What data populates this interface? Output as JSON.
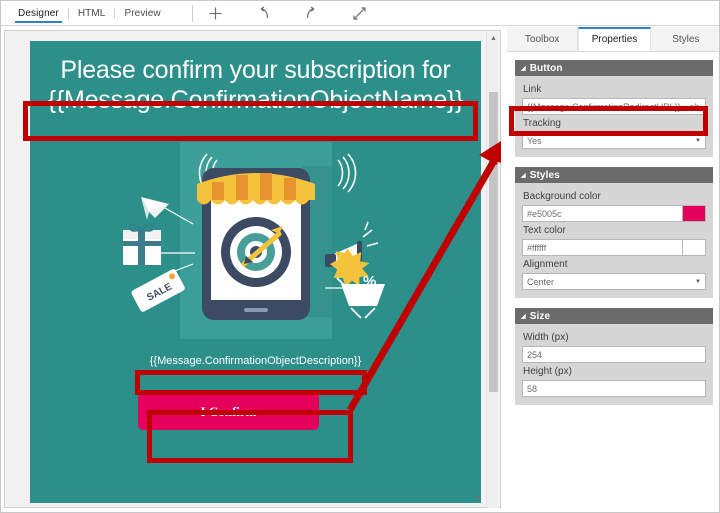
{
  "toolbar": {
    "modes": [
      {
        "label": "Designer",
        "active": true
      },
      {
        "label": "HTML",
        "active": false
      },
      {
        "label": "Preview",
        "active": false
      }
    ],
    "icons": [
      {
        "name": "add-icon",
        "glyph": "+"
      },
      {
        "name": "undo-icon",
        "glyph": "↺"
      },
      {
        "name": "redo-icon",
        "glyph": "↻"
      },
      {
        "name": "collapse-icon",
        "glyph": "⤡"
      }
    ]
  },
  "canvas": {
    "background_color": "#2d8f8a",
    "headline_line1": "Please confirm your subscription for",
    "headline_line2": "{{Message.ConfirmationObjectName}}",
    "description": "{{Message.ConfirmationObjectDescription}}",
    "button_label": "I Confirm",
    "button_color": "#e5005c",
    "scroll_up_arrow": "▲",
    "scroll_down_arrow": "▼",
    "illustration_name": "mobile-marketing-illustration",
    "illustration_elements": [
      "smartphone",
      "shop-awning",
      "dartboard-target",
      "arrow",
      "gift-box",
      "sale-tag",
      "megaphone",
      "shopping-cart",
      "percent-badge",
      "paper-plane",
      "wifi-signal"
    ]
  },
  "properties_panel": {
    "tabs": [
      {
        "label": "Toolbox",
        "active": false
      },
      {
        "label": "Properties",
        "active": true
      },
      {
        "label": "Styles",
        "active": false
      }
    ],
    "sections": [
      {
        "title": "Button",
        "caret": "◢",
        "fields": [
          {
            "label": "Link",
            "value": "{{Message.ConfirmationRedirectURL}}",
            "type": "text-code",
            "code_glyph": "</>"
          },
          {
            "label": "Tracking",
            "value": "Yes",
            "type": "select",
            "caret": "▼"
          }
        ]
      },
      {
        "title": "Styles",
        "caret": "◢",
        "fields": [
          {
            "label": "Background color",
            "value": "#e5005c",
            "type": "color",
            "swatch": "#e5005c"
          },
          {
            "label": "Text color",
            "value": "#ffffff",
            "type": "color",
            "swatch": "#ffffff"
          },
          {
            "label": "Alignment",
            "value": "Center",
            "type": "select",
            "caret": "▼"
          }
        ]
      },
      {
        "title": "Size",
        "caret": "◢",
        "fields": [
          {
            "label": "Width (px)",
            "value": "254",
            "type": "text"
          },
          {
            "label": "Height (px)",
            "value": "58",
            "type": "text"
          }
        ]
      }
    ]
  },
  "annotations": {
    "highlight_color": "#c00000",
    "boxes": [
      "headline-placeholder-highlight",
      "description-placeholder-highlight",
      "confirm-button-highlight",
      "link-field-highlight"
    ],
    "arrow": "button-to-link-field-arrow"
  }
}
